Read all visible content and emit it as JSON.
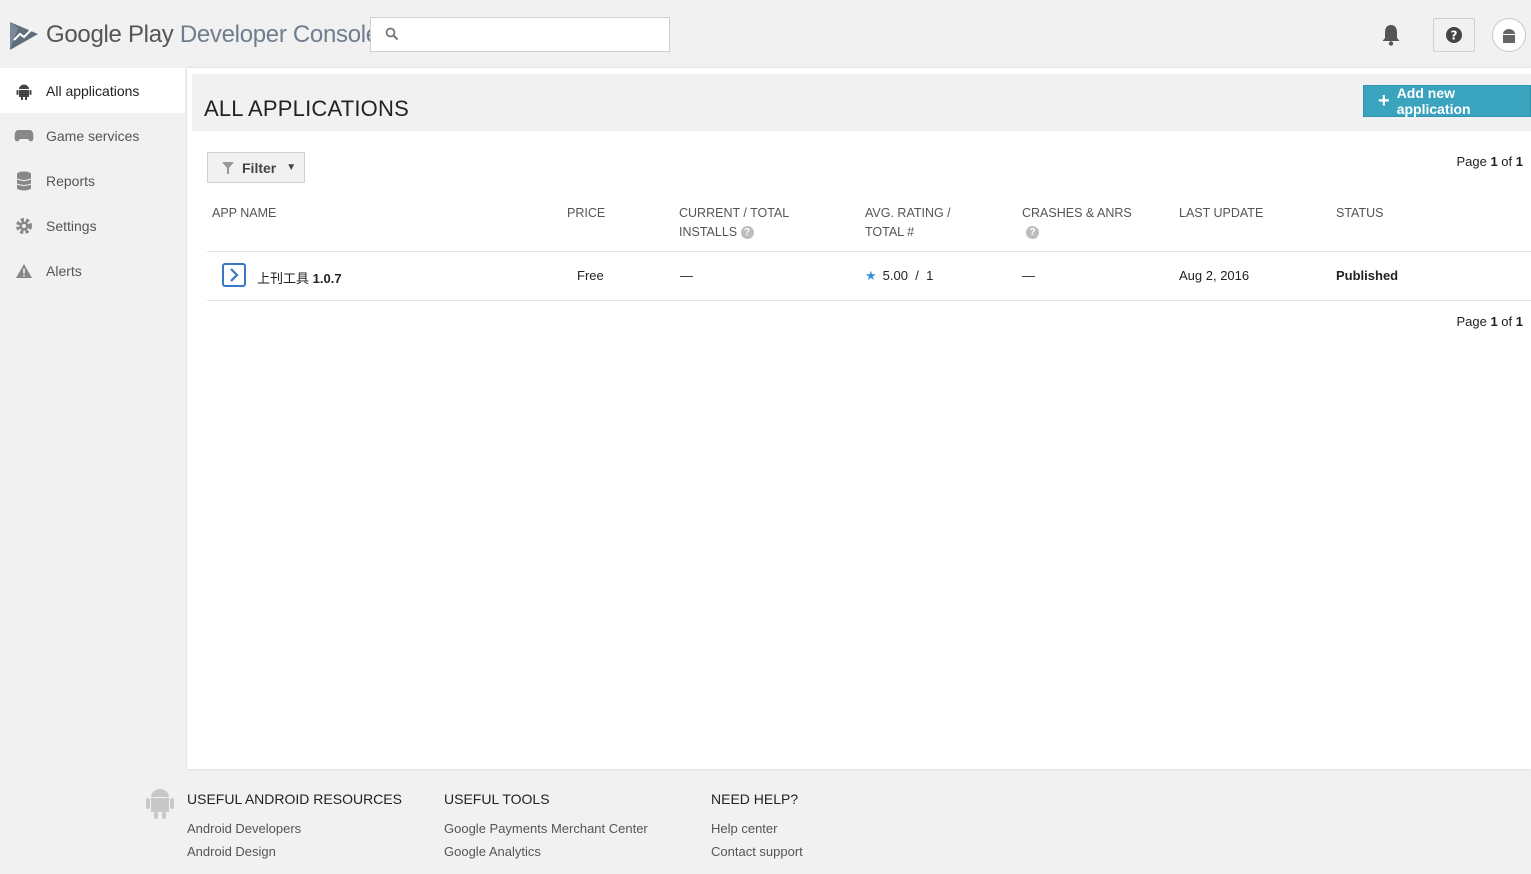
{
  "header": {
    "logo_google_play": "Google Play",
    "logo_developer_console": "Developer Console",
    "search_placeholder": ""
  },
  "sidebar": {
    "items": [
      {
        "label": "All applications",
        "icon": "android-icon",
        "active": true
      },
      {
        "label": "Game services",
        "icon": "gamepad-icon"
      },
      {
        "label": "Reports",
        "icon": "database-icon"
      },
      {
        "label": "Settings",
        "icon": "gear-icon"
      },
      {
        "label": "Alerts",
        "icon": "warning-icon"
      }
    ]
  },
  "main": {
    "title": "ALL APPLICATIONS",
    "add_button": "Add new application",
    "filter_button": "Filter",
    "pager": {
      "prefix": "Page",
      "current": "1",
      "of": "of",
      "total": "1"
    },
    "columns": {
      "app_name": "APP NAME",
      "price": "PRICE",
      "installs_line1": "CURRENT / TOTAL",
      "installs_line2": "INSTALLS",
      "rating_line1": "AVG. RATING /",
      "rating_line2": "TOTAL #",
      "crashes": "CRASHES & ANRS",
      "last_update": "LAST UPDATE",
      "status": "STATUS"
    },
    "rows": [
      {
        "app_name": "上刊工具",
        "version": "1.0.7",
        "price": "Free",
        "installs": "—",
        "rating": "5.00",
        "rating_sep": "/",
        "rating_total": "1",
        "crashes": "—",
        "last_update": "Aug 2, 2016",
        "status": "Published"
      }
    ]
  },
  "footer": {
    "resources": {
      "title": "USEFUL ANDROID RESOURCES",
      "links": [
        "Android Developers",
        "Android Design"
      ]
    },
    "tools": {
      "title": "USEFUL TOOLS",
      "links": [
        "Google Payments Merchant Center",
        "Google Analytics"
      ]
    },
    "help": {
      "title": "NEED HELP?",
      "links": [
        "Help center",
        "Contact support"
      ]
    }
  },
  "colors": {
    "accent": "#3aa4bf",
    "star": "#3a8fd6",
    "app_icon": "#3b78c4"
  }
}
